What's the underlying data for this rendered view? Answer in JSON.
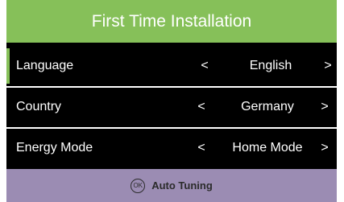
{
  "title": "First Time Installation",
  "rows": [
    {
      "label": "Language",
      "left_arrow": "<",
      "value": "English",
      "right_arrow": ">"
    },
    {
      "label": "Country",
      "left_arrow": "<",
      "value": "Germany",
      "right_arrow": ">"
    },
    {
      "label": "Energy Mode",
      "left_arrow": "<",
      "value": "Home Mode",
      "right_arrow": ">"
    }
  ],
  "footer": {
    "ok_icon_text": "OK",
    "action_label": "Auto Tuning"
  },
  "colors": {
    "header_green": "#86c059",
    "footer_purple": "#9b8cb3",
    "background": "#000000"
  }
}
